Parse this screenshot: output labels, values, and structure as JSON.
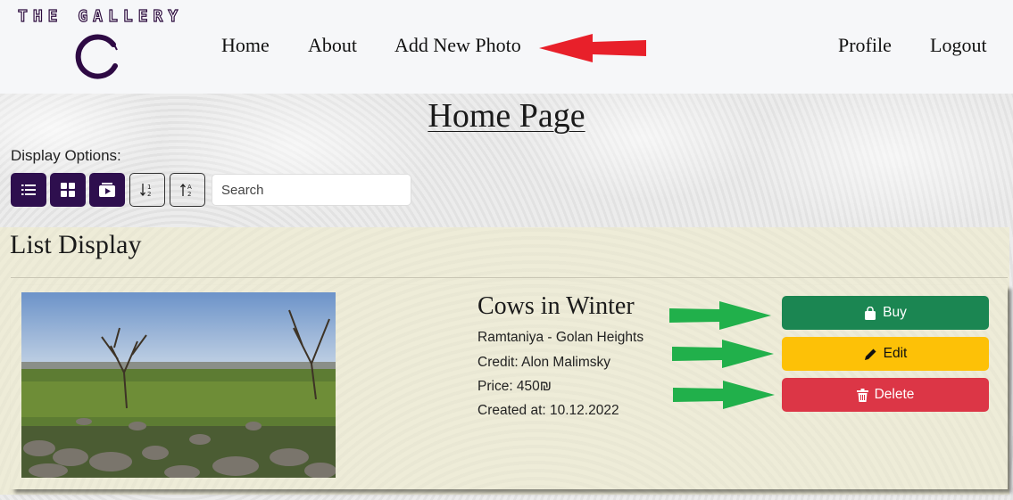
{
  "header": {
    "logo_text": "THE GALLERY",
    "nav": {
      "home": "Home",
      "about": "About",
      "add_photo": "Add New Photo",
      "profile": "Profile",
      "logout": "Logout"
    }
  },
  "main": {
    "page_title": "Home Page",
    "display_options_label": "Display Options:",
    "view_buttons": [
      "list-icon",
      "grid-icon",
      "slideshow-icon"
    ],
    "sort_buttons": [
      "sort-numeric-desc-icon",
      "sort-alpha-asc-icon"
    ],
    "search": {
      "placeholder": "Search",
      "value": ""
    },
    "section_title": "List Display"
  },
  "photo": {
    "title": "Cows in Winter",
    "location": "Ramtaniya - Golan Heights",
    "credit": "Credit: Alon Malimsky",
    "price": "Price: 450₪",
    "created": "Created at: 10.12.2022",
    "actions": {
      "buy": "Buy",
      "edit": "Edit",
      "delete": "Delete"
    }
  },
  "colors": {
    "brand_purple": "#2e0f4e",
    "buy_green": "#1b8652",
    "edit_yellow": "#fdc107",
    "delete_red": "#dc3646",
    "annotation_red": "#e8202a",
    "annotation_green": "#21b04b"
  }
}
